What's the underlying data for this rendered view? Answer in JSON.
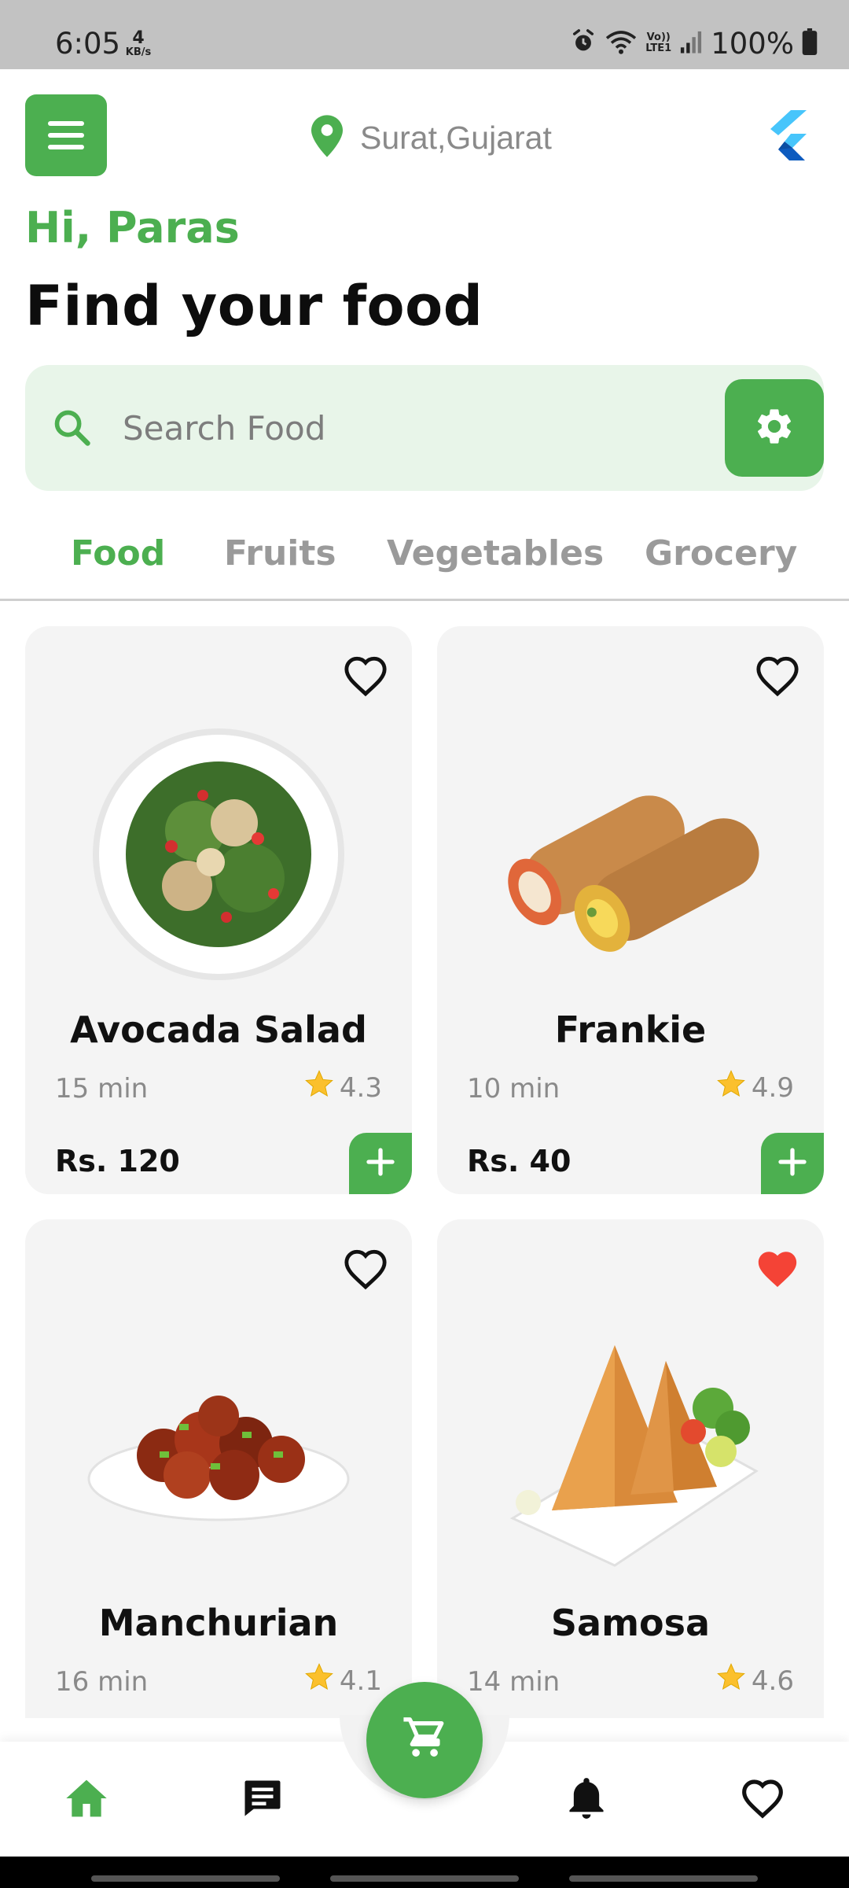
{
  "status_bar": {
    "time": "6:05",
    "net_speed_value": "4",
    "net_speed_unit": "KB/s",
    "lte_label_top": "Vo))",
    "lte_label_bottom": "LTE1",
    "battery": "100%",
    "icons": [
      "alarm-icon",
      "wifi-icon",
      "signal-icon",
      "battery-icon"
    ]
  },
  "header": {
    "menu_icon": "hamburger-icon",
    "location": "Surat,Gujarat",
    "location_icon": "map-pin-icon",
    "logo_icon": "flutter-logo-icon"
  },
  "greeting": "Hi, Paras",
  "title": "Find your food",
  "search": {
    "placeholder": "Search Food",
    "value": "",
    "filter_icon": "settings-gear-icon"
  },
  "tabs": [
    {
      "label": "Food",
      "active": true
    },
    {
      "label": "Fruits",
      "active": false
    },
    {
      "label": "Vegetables",
      "active": false
    },
    {
      "label": "Grocery",
      "active": false
    }
  ],
  "products": [
    {
      "name": "Avocada Salad",
      "time": "15 min",
      "rating": "4.3",
      "price": "Rs. 120",
      "favorite": false
    },
    {
      "name": "Frankie",
      "time": "10 min",
      "rating": "4.9",
      "price": "Rs. 40",
      "favorite": false
    },
    {
      "name": "Manchurian",
      "time": "16 min",
      "rating": "4.1",
      "price": "",
      "favorite": false
    },
    {
      "name": "Samosa",
      "time": "14 min",
      "rating": "4.6",
      "price": "",
      "favorite": true
    }
  ],
  "bottom_nav": {
    "items": [
      "home-icon",
      "chat-icon",
      "bell-icon",
      "heart-icon"
    ],
    "active": "home-icon",
    "fab_icon": "cart-icon"
  },
  "colors": {
    "accent": "#4caf50",
    "search_bg": "#e8f5e9",
    "card_bg": "#f4f4f4",
    "favorite_active": "#f44336",
    "star": "#fbc02d"
  }
}
